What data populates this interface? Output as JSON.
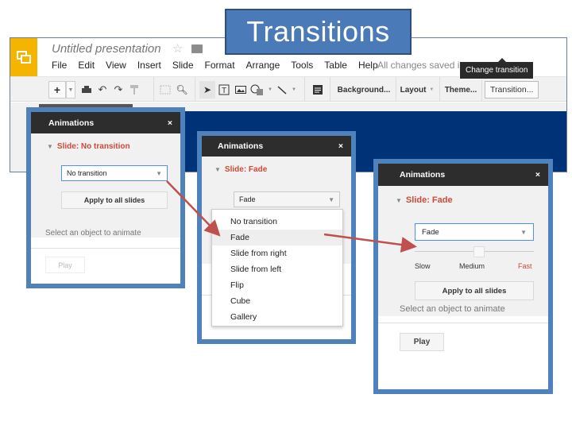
{
  "title_badge": "Transitions",
  "app": {
    "doc_title": "Untitled presentation",
    "menu": [
      "File",
      "Edit",
      "View",
      "Insert",
      "Slide",
      "Format",
      "Arrange",
      "Tools",
      "Table",
      "Help"
    ],
    "save_status": "All changes saved in Drive",
    "toolbar": {
      "new_slide": "+",
      "background": "Background...",
      "layout": "Layout",
      "theme": "Theme...",
      "transition": "Transition..."
    },
    "tooltip": "Change transition",
    "brand_color": "#f4b400"
  },
  "panels": [
    {
      "header": "Animations",
      "close": "×",
      "slide_label": "Slide: No transition",
      "transition_value": "No transition",
      "apply_label": "Apply to all slides",
      "hint": "Select an object to animate",
      "play_label": "Play",
      "play_enabled": false
    },
    {
      "header": "Animations",
      "close": "×",
      "slide_label": "Slide: Fade",
      "transition_value": "Fade",
      "dropdown_open": true,
      "options": [
        "No transition",
        "Fade",
        "Slide from right",
        "Slide from left",
        "Flip",
        "Cube",
        "Gallery"
      ],
      "highlighted_option": "Fade"
    },
    {
      "header": "Animations",
      "close": "×",
      "slide_label": "Slide: Fade",
      "transition_value": "Fade",
      "speed_labels": [
        "Slow",
        "Medium",
        "Fast"
      ],
      "speed_selected": "Fast",
      "apply_label": "Apply to all slides",
      "hint": "Select an object to animate",
      "play_label": "Play",
      "play_enabled": true
    }
  ],
  "colors": {
    "accent_red": "#d14836",
    "frame_blue": "#4f81bd",
    "arrow": "#c0504d",
    "slide_bg": "#003278"
  }
}
